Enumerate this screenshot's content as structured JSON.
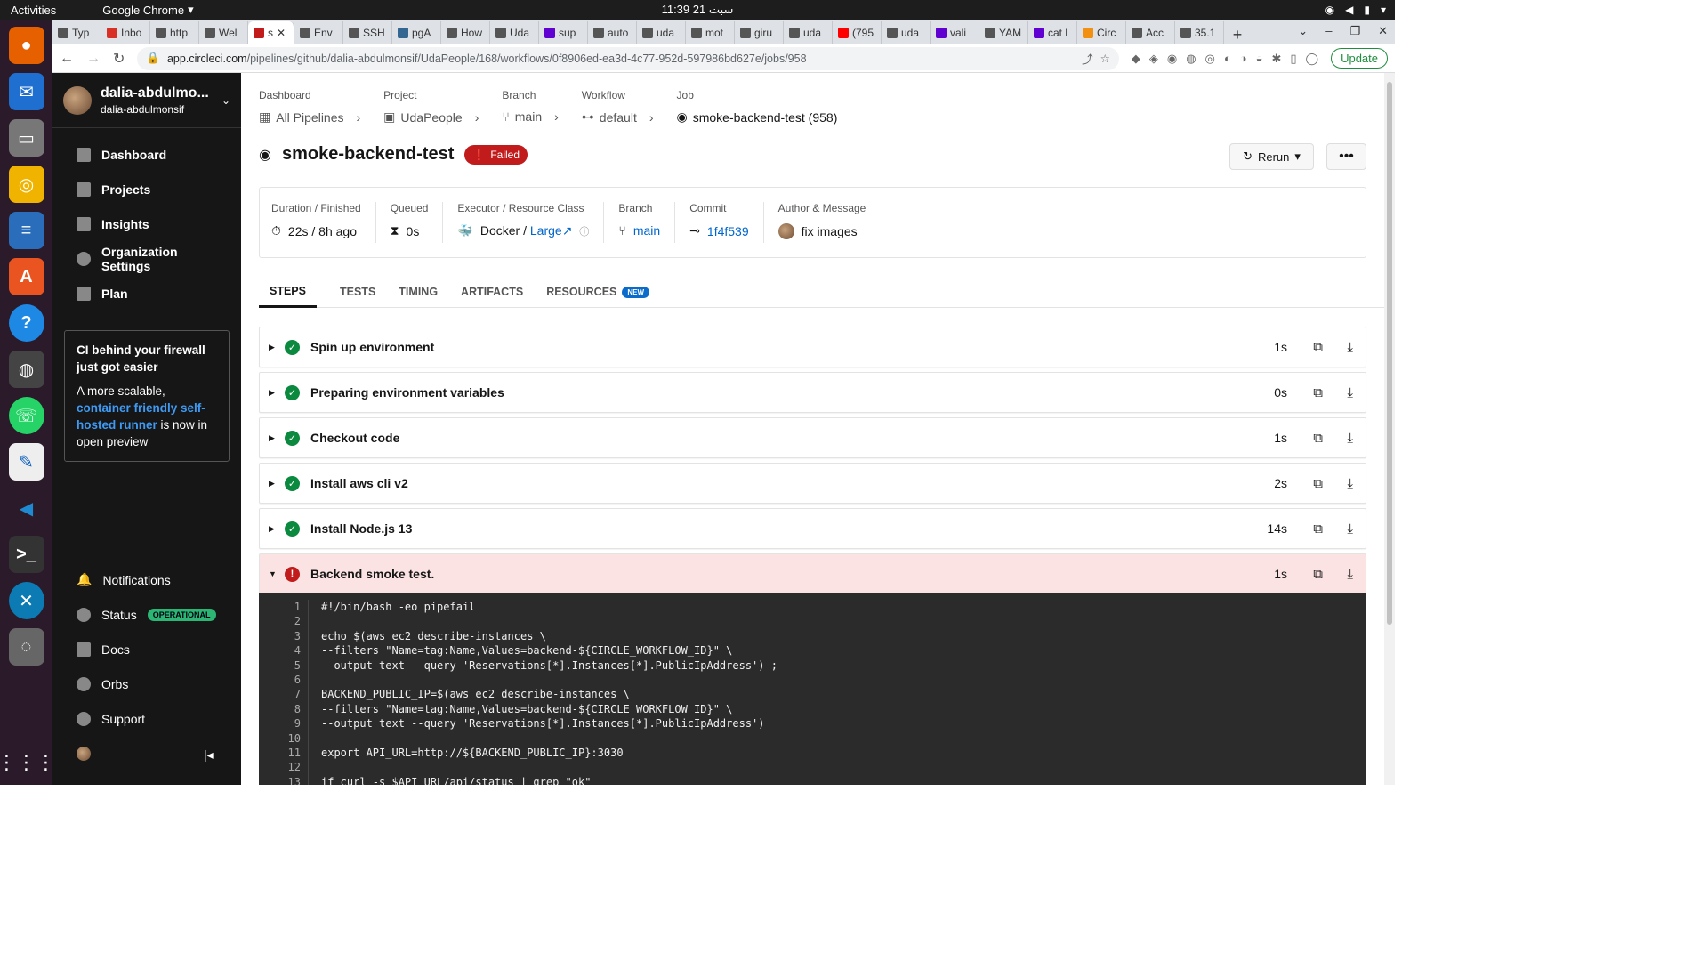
{
  "system": {
    "activities": "Activities",
    "app_name": "Google Chrome",
    "clock": "11:39  21 سبت"
  },
  "browser": {
    "tabs": [
      {
        "label": "Typ"
      },
      {
        "label": "Inbo"
      },
      {
        "label": "http"
      },
      {
        "label": "Wel"
      },
      {
        "label": "s",
        "active": true
      },
      {
        "label": "Env"
      },
      {
        "label": "SSH"
      },
      {
        "label": "pgA"
      },
      {
        "label": "How"
      },
      {
        "label": "Uda"
      },
      {
        "label": "sup"
      },
      {
        "label": "auto"
      },
      {
        "label": "uda"
      },
      {
        "label": "mot"
      },
      {
        "label": "giru"
      },
      {
        "label": "uda"
      },
      {
        "label": "(795"
      },
      {
        "label": "uda"
      },
      {
        "label": "vali"
      },
      {
        "label": "YAM"
      },
      {
        "label": "cat l"
      },
      {
        "label": "Circ"
      },
      {
        "label": "Acc"
      },
      {
        "label": "35.1"
      }
    ],
    "url_host": "app.circleci.com",
    "url_path": "/pipelines/github/dalia-abdulmonsif/UdaPeople/168/workflows/0f8906ed-ea3d-4c77-952d-597986bd627e/jobs/958",
    "update_label": "Update"
  },
  "sidebar": {
    "org_name": "dalia-abdulmo...",
    "org_sub": "dalia-abdulmonsif",
    "nav": [
      "Dashboard",
      "Projects",
      "Insights",
      "Organization Settings",
      "Plan"
    ],
    "promo": {
      "title": "CI behind your firewall just got easier",
      "text_before": "A more scalable, ",
      "link": "container friendly self-hosted runner",
      "text_after": " is now in open preview"
    },
    "bottom": {
      "notifications": "Notifications",
      "status": "Status",
      "status_badge": "OPERATIONAL",
      "docs": "Docs",
      "orbs": "Orbs",
      "support": "Support"
    }
  },
  "breadcrumb": {
    "dashboard": {
      "label": "Dashboard",
      "value": "All Pipelines"
    },
    "project": {
      "label": "Project",
      "value": "UdaPeople"
    },
    "branch": {
      "label": "Branch",
      "value": "main"
    },
    "workflow": {
      "label": "Workflow",
      "value": "default"
    },
    "job": {
      "label": "Job",
      "value": "smoke-backend-test (958)"
    }
  },
  "job": {
    "name": "smoke-backend-test",
    "status": "Failed",
    "rerun_label": "Rerun",
    "info": {
      "duration_label": "Duration / Finished",
      "duration_value": "22s / 8h ago",
      "queued_label": "Queued",
      "queued_value": "0s",
      "executor_label": "Executor / Resource Class",
      "executor_value": "Docker / ",
      "resource_class": "Large",
      "branch_label": "Branch",
      "branch_value": "main",
      "commit_label": "Commit",
      "commit_value": "1f4f539",
      "author_label": "Author & Message",
      "author_message": "fix images"
    }
  },
  "tabs": {
    "steps": "STEPS",
    "tests": "TESTS",
    "timing": "TIMING",
    "artifacts": "ARTIFACTS",
    "resources": "RESOURCES",
    "resources_badge": "NEW"
  },
  "steps": [
    {
      "name": "Spin up environment",
      "duration": "1s"
    },
    {
      "name": "Preparing environment variables",
      "duration": "0s"
    },
    {
      "name": "Checkout code",
      "duration": "1s"
    },
    {
      "name": "Install aws cli v2",
      "duration": "2s"
    },
    {
      "name": "Install Node.js 13",
      "duration": "14s"
    },
    {
      "name": "Backend smoke test.",
      "duration": "1s",
      "failed": true
    }
  ],
  "code_lines": [
    "#!/bin/bash -eo pipefail",
    "",
    "echo $(aws ec2 describe-instances \\",
    "--filters \"Name=tag:Name,Values=backend-${CIRCLE_WORKFLOW_ID}\" \\",
    "--output text --query 'Reservations[*].Instances[*].PublicIpAddress') ;",
    "",
    "BACKEND_PUBLIC_IP=$(aws ec2 describe-instances \\",
    "--filters \"Name=tag:Name,Values=backend-${CIRCLE_WORKFLOW_ID}\" \\",
    "--output text --query 'Reservations[*].Instances[*].PublicIpAddress')",
    "",
    "export API_URL=http://${BACKEND_PUBLIC_IP}:3030",
    "",
    "if curl -s $API_URL/api/status | grep \"ok\""
  ],
  "colors": {
    "success": "#0b8a3f",
    "failed": "#c21b1b",
    "sidebar_bg": "#161616",
    "link": "#0066cc"
  }
}
